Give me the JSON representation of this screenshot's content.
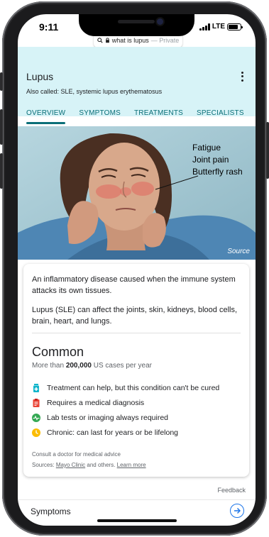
{
  "status": {
    "time": "9:11",
    "network": "LTE"
  },
  "browser": {
    "query": "what is lupus",
    "mode": "— Private"
  },
  "header": {
    "title": "Lupus",
    "also_called": "Also called: SLE, systemic lupus erythematosus",
    "tabs": [
      "OVERVIEW",
      "SYMPTOMS",
      "TREATMENTS",
      "SPECIALISTS"
    ],
    "active_tab": 0
  },
  "illustration": {
    "labels": [
      "Fatigue",
      "Joint pain",
      "Butterfly rash"
    ],
    "source": "Source"
  },
  "card": {
    "description1": "An inflammatory disease caused when the immune system attacks its own tissues.",
    "description2": "Lupus (SLE) can affect the joints, skin, kidneys, blood cells, brain, heart, and lungs.",
    "prevalence_title": "Common",
    "cases_prefix": "More than",
    "cases_count": "200,000",
    "cases_suffix": "US cases per year",
    "facts": [
      {
        "icon": "medicine-bottle-icon",
        "color": "#12b5cb",
        "text": "Treatment can help, but this condition can't be cured"
      },
      {
        "icon": "clipboard-icon",
        "color": "#ea4335",
        "text": "Requires a medical diagnosis"
      },
      {
        "icon": "heartbeat-icon",
        "color": "#34a853",
        "text": "Lab tests or imaging always required"
      },
      {
        "icon": "clock-icon",
        "color": "#fbbc04",
        "text": "Chronic: can last for years or be lifelong"
      }
    ],
    "consult": "Consult a doctor for medical advice",
    "sources_prefix": "Sources:",
    "source_link": "Mayo Clinic",
    "sources_middle": "and others.",
    "learn_more": "Learn more"
  },
  "feedback": "Feedback",
  "next_section": {
    "title": "Symptoms"
  },
  "colors": {
    "accent": "#0b6f78",
    "header_bg": "#d7f3f7",
    "link_blue": "#1a73e8"
  }
}
